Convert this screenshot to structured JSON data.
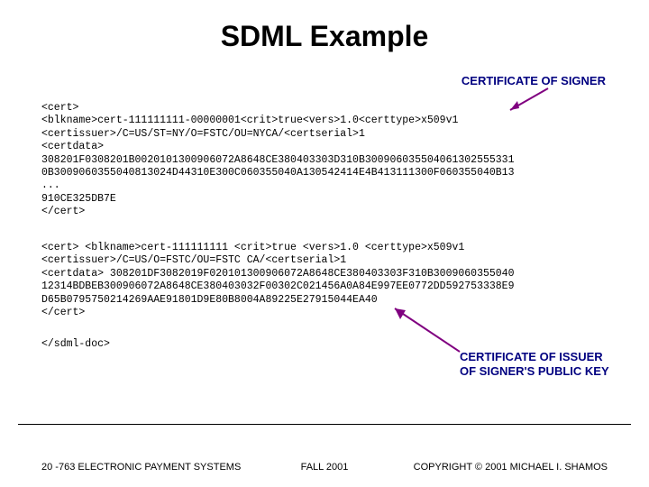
{
  "title": "SDML Example",
  "labels": {
    "signer": "CERTIFICATE OF SIGNER",
    "issuer_line1": "CERTIFICATE OF ISSUER",
    "issuer_line2": "OF SIGNER'S PUBLIC KEY"
  },
  "code": {
    "block1": "<cert>\n<blkname>cert-111111111-00000001<crit>true<vers>1.0<certtype>x509v1\n<certissuer>/C=US/ST=NY/O=FSTC/OU=NYCA/<certserial>1\n<certdata>\n308201F0308201B0020101300906072A8648CE380403303D310B300906035504061302555331\n0B3009060355040813024D44310E300C060355040A130542414E4B413111300F060355040B13\n...\n910CE325DB7E\n</cert>",
    "block2": "<cert> <blkname>cert-111111111 <crit>true <vers>1.0 <certtype>x509v1\n<certissuer>/C=US/O=FSTC/OU=FSTC CA/<certserial>1\n<certdata> 308201DF3082019F020101300906072A8648CE380403303F310B3009060355040\n12314BDBEB300906072A8648CE380403032F00302C021456A0A84E997EE0772DD592753338E9\nD65B0795750214269AAE91801D9E80B8004A89225E27915044EA40\n</cert>",
    "block3": "</sdml-doc>"
  },
  "footer": {
    "left": "20 -763 ELECTRONIC PAYMENT SYSTEMS",
    "center": "FALL 2001",
    "right": "COPYRIGHT © 2001 MICHAEL I. SHAMOS"
  }
}
